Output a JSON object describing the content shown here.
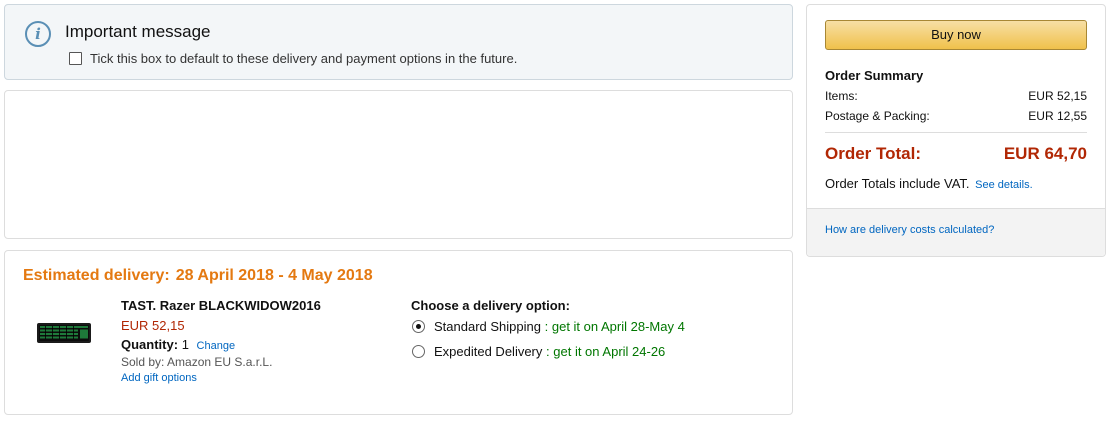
{
  "message": {
    "title": "Important message",
    "checkbox_label": "Tick this box to default to these delivery and payment options in the future."
  },
  "delivery": {
    "estimated_label": "Estimated delivery:",
    "estimated_date": "28 April 2018 - 4 May 2018",
    "product": {
      "name": "TAST. Razer BLACKWIDOW2016",
      "price": "EUR 52,15",
      "quantity_label": "Quantity:",
      "quantity": "1",
      "change_link": "Change",
      "sold_by": "Sold by: Amazon EU S.a.r.L.",
      "gift_link": "Add gift options"
    },
    "options_title": "Choose a delivery option:",
    "options": [
      {
        "name": "Standard Shipping",
        "separator": ":",
        "when": "get it on April 28-May 4",
        "selected": true
      },
      {
        "name": "Expedited Delivery",
        "separator": ":",
        "when": "get it on April 24-26",
        "selected": false
      }
    ]
  },
  "summary": {
    "buy_label": "Buy now",
    "title": "Order Summary",
    "items_label": "Items:",
    "items_value": "EUR 52,15",
    "postage_label": "Postage & Packing:",
    "postage_value": "EUR 12,55",
    "total_label": "Order Total:",
    "total_value": "EUR 64,70",
    "vat_text": "Order Totals include VAT.",
    "vat_link": "See details.",
    "delivery_costs_link": "How are delivery costs calculated?"
  },
  "colors": {
    "accent_orange": "#e47911",
    "price_red": "#b12704",
    "link_blue": "#0066c0",
    "delivery_green": "#007600",
    "button_yellow": "#f0c14b"
  }
}
